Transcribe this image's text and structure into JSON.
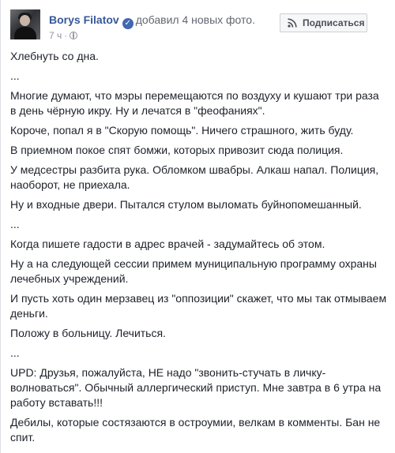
{
  "post": {
    "author": "Borys Filatov",
    "action_text": "добавил 4 новых фото.",
    "time": "7 ч",
    "separator": "·",
    "subscribe_label": "Подписаться",
    "verified_mark": "✓",
    "paragraphs": [
      "Хлебнуть со дна.",
      "...",
      "Многие думают, что мэры перемещаются по воздуху и кушают три раза в день чёрную икру. Ну и лечатся в \"феофаниях\".",
      "Короче, попал я в \"Скорую помощь\". Ничего страшного, жить буду.",
      "В приемном покое спят бомжи, которых привозит сюда полиция.",
      "У медсестры разбита рука. Обломком швабры. Алкаш напал. Полиция, наоборот, не приехала.",
      "Ну и входные двери. Пытался стулом выломать буйнопомешанный.",
      "...",
      "Когда пишете гадости в адрес врачей - задумайтесь об этом.",
      "Ну а на следующей сессии примем муниципальную программу охраны лечебных учреждений.",
      "И пусть хоть один мерзавец из \"оппозиции\" скажет, что мы так отмываем деньги.",
      "Положу в больницу. Лечиться.",
      "...",
      "UPD: Друзья, пожалуйста, НЕ надо \"звонить-стучать в личку-волноваться\". Обычный аллергический приступ. Мне завтра в 6 утра на работу вставать!!!",
      "Дебилы, которые состязаются в остроумии, велкам в комменты. Бан не спит."
    ]
  },
  "colors": {
    "author": "#365899",
    "meta": "#90949c",
    "verified": "#4267b2",
    "text": "#1d2129"
  },
  "icons": {
    "verified": "verified-badge-icon",
    "audience": "globe-icon",
    "subscribe": "rss-icon"
  }
}
